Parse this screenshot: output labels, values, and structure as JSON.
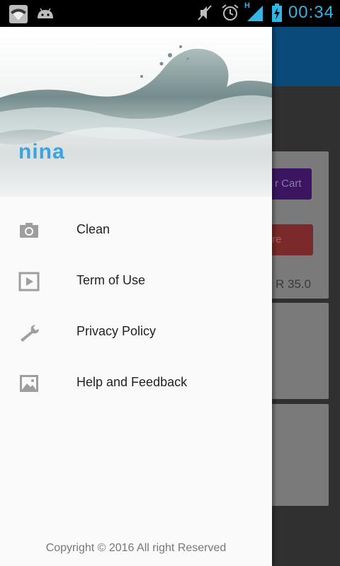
{
  "status_bar": {
    "time": "00:34",
    "icons_left": [
      "wifi-icon",
      "android-icon"
    ],
    "icons_right": [
      "mute-icon",
      "alarm-icon",
      "signal-icon",
      "battery-charging-icon"
    ],
    "network_type": "H"
  },
  "background_app": {
    "cart_button_label": "r Cart",
    "red_button_label": "re",
    "price": "R 35.0"
  },
  "drawer": {
    "brand": "nina",
    "menu": [
      {
        "label": "Clean",
        "icon": "camera-icon"
      },
      {
        "label": "Term of Use",
        "icon": "play-icon"
      },
      {
        "label": "Privacy Policy",
        "icon": "wrench-icon"
      },
      {
        "label": "Help and Feedback",
        "icon": "image-icon"
      }
    ],
    "footer": "Copyright © 2016 All right Reserved"
  },
  "colors": {
    "accent": "#33b5e5",
    "toolbar": "#0a4a7a",
    "brand": "#3aa3e0"
  }
}
